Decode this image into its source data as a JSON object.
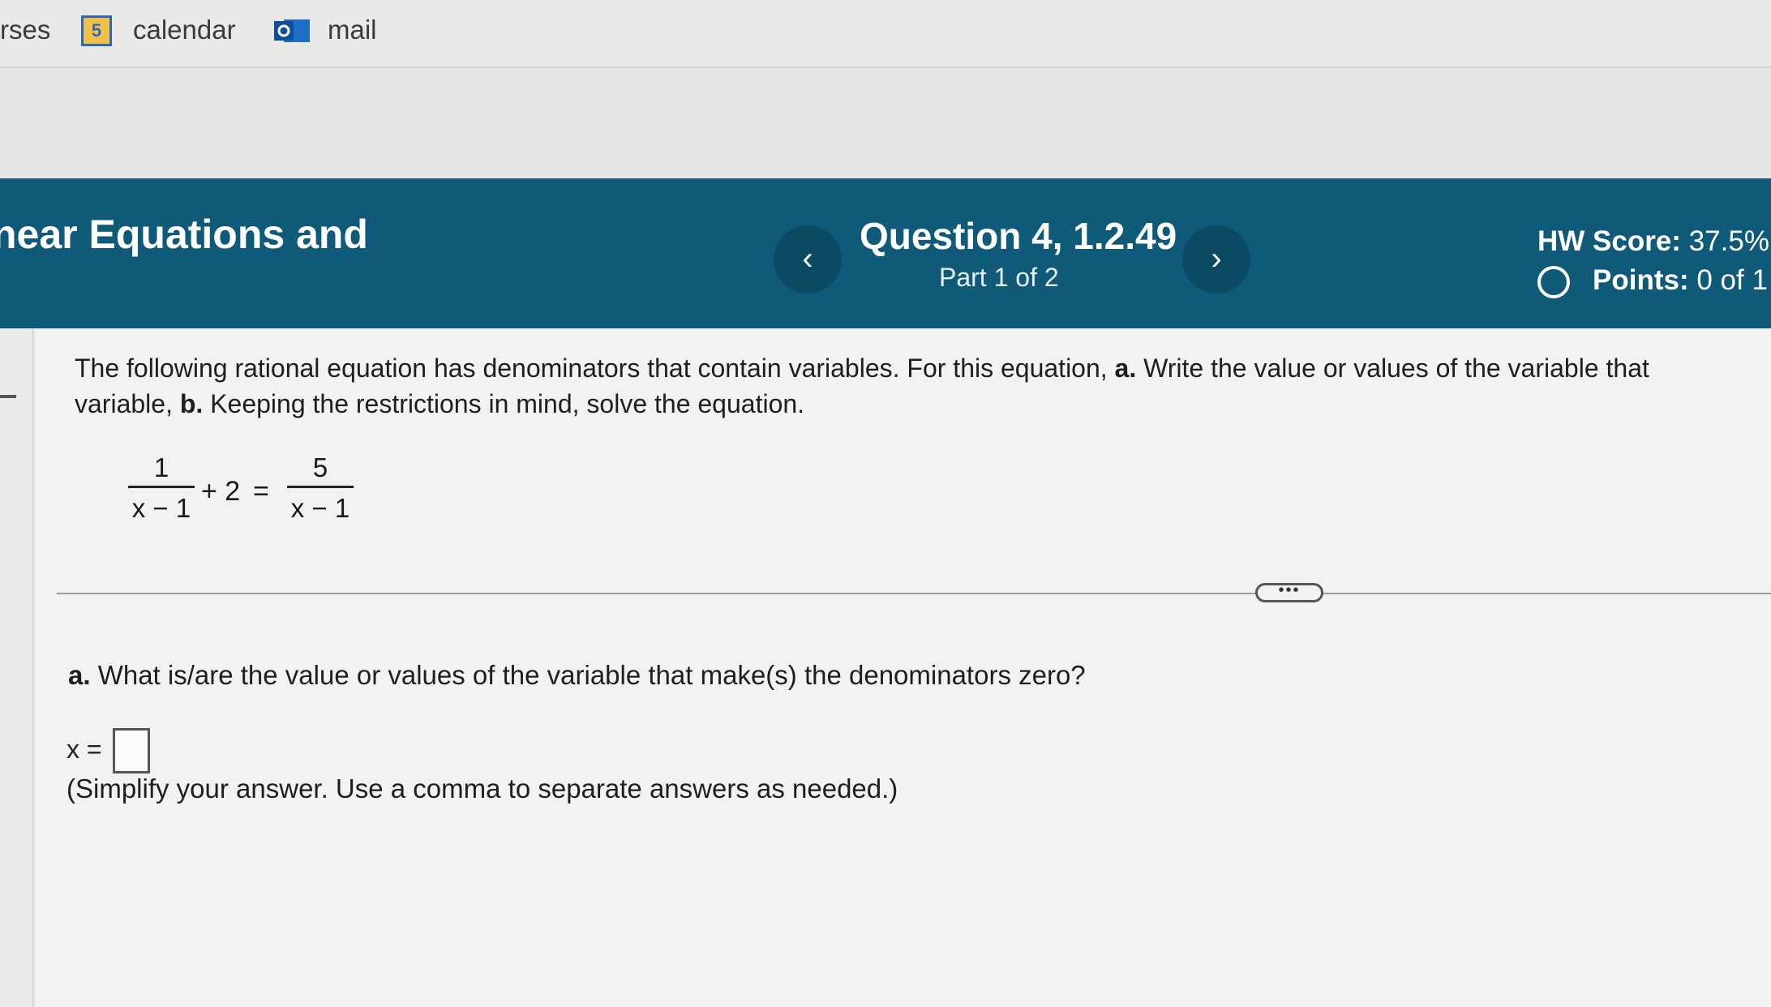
{
  "bookmarks": {
    "partial_label": "rses",
    "calendar_icon_digit": "5",
    "calendar_label": "calendar",
    "mail_label": "mail"
  },
  "header": {
    "assignment_title": "near Equations and",
    "question_title": "Question 4, 1.2.49",
    "part": "Part 1 of 2",
    "prev_glyph": "‹",
    "next_glyph": "›",
    "hw_score_label": "HW Score:",
    "hw_score_value": "37.5%",
    "points_label": "Points:",
    "points_value": "0 of 1",
    "colors": {
      "band": "#0f5a78",
      "button": "#0c4a63"
    }
  },
  "problem": {
    "line1_a": "The following rational equation has denominators that contain variables. For this equation, ",
    "line1_b_bold": "a.",
    "line1_c": " Write the value or values of the variable that",
    "line2_a": "variable, ",
    "line2_b_bold": "b.",
    "line2_c": " Keeping the restrictions in mind, solve the equation.",
    "equation": {
      "left_numerator": "1",
      "left_denominator": "x − 1",
      "operator_plus": "+ 2",
      "equals": "=",
      "right_numerator": "5",
      "right_denominator": "x − 1"
    }
  },
  "more_button_label": "•••",
  "part_a": {
    "label_bold": "a.",
    "question": " What is/are the value or values of the variable that make(s) the denominators zero?",
    "answer_prefix": "x =",
    "hint": "(Simplify your answer. Use a comma to separate answers as needed.)"
  }
}
